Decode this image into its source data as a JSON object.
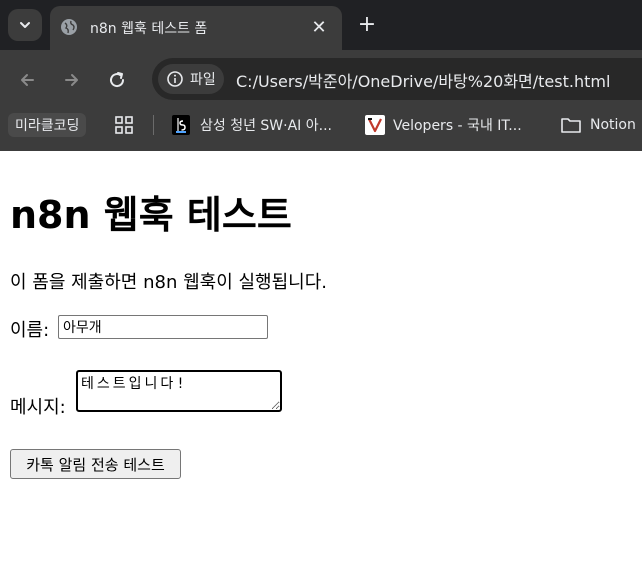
{
  "browser": {
    "tab": {
      "title": "n8n 웹훅 테스트 폼",
      "globe_icon": "globe-icon",
      "close_symbol": "✕"
    },
    "new_tab_symbol": "+",
    "omnibox": {
      "site_label": "파일",
      "url": "C:/Users/박준아/OneDrive/바탕%20화면/test.html"
    },
    "bookmarks": [
      {
        "label": "미라클코딩"
      },
      {
        "label": "삼성 청년 SW·AI 아..."
      },
      {
        "label": "Velopers - 국내 IT..."
      },
      {
        "label": "Notion"
      }
    ],
    "colors": {
      "chrome": "#3c3c3c",
      "tabstrip": "#202124",
      "text": "#e8eaed"
    }
  },
  "page": {
    "heading": "n8n 웹훅 테스트",
    "description": "이 폼을 제출하면 n8n 웹훅이 실행됩니다.",
    "form": {
      "name_label": "이름:",
      "name_value": "아무개",
      "message_label": "메시지:",
      "message_value": "테스트입니다!",
      "submit_label": "카톡 알림 전송 테스트"
    }
  }
}
